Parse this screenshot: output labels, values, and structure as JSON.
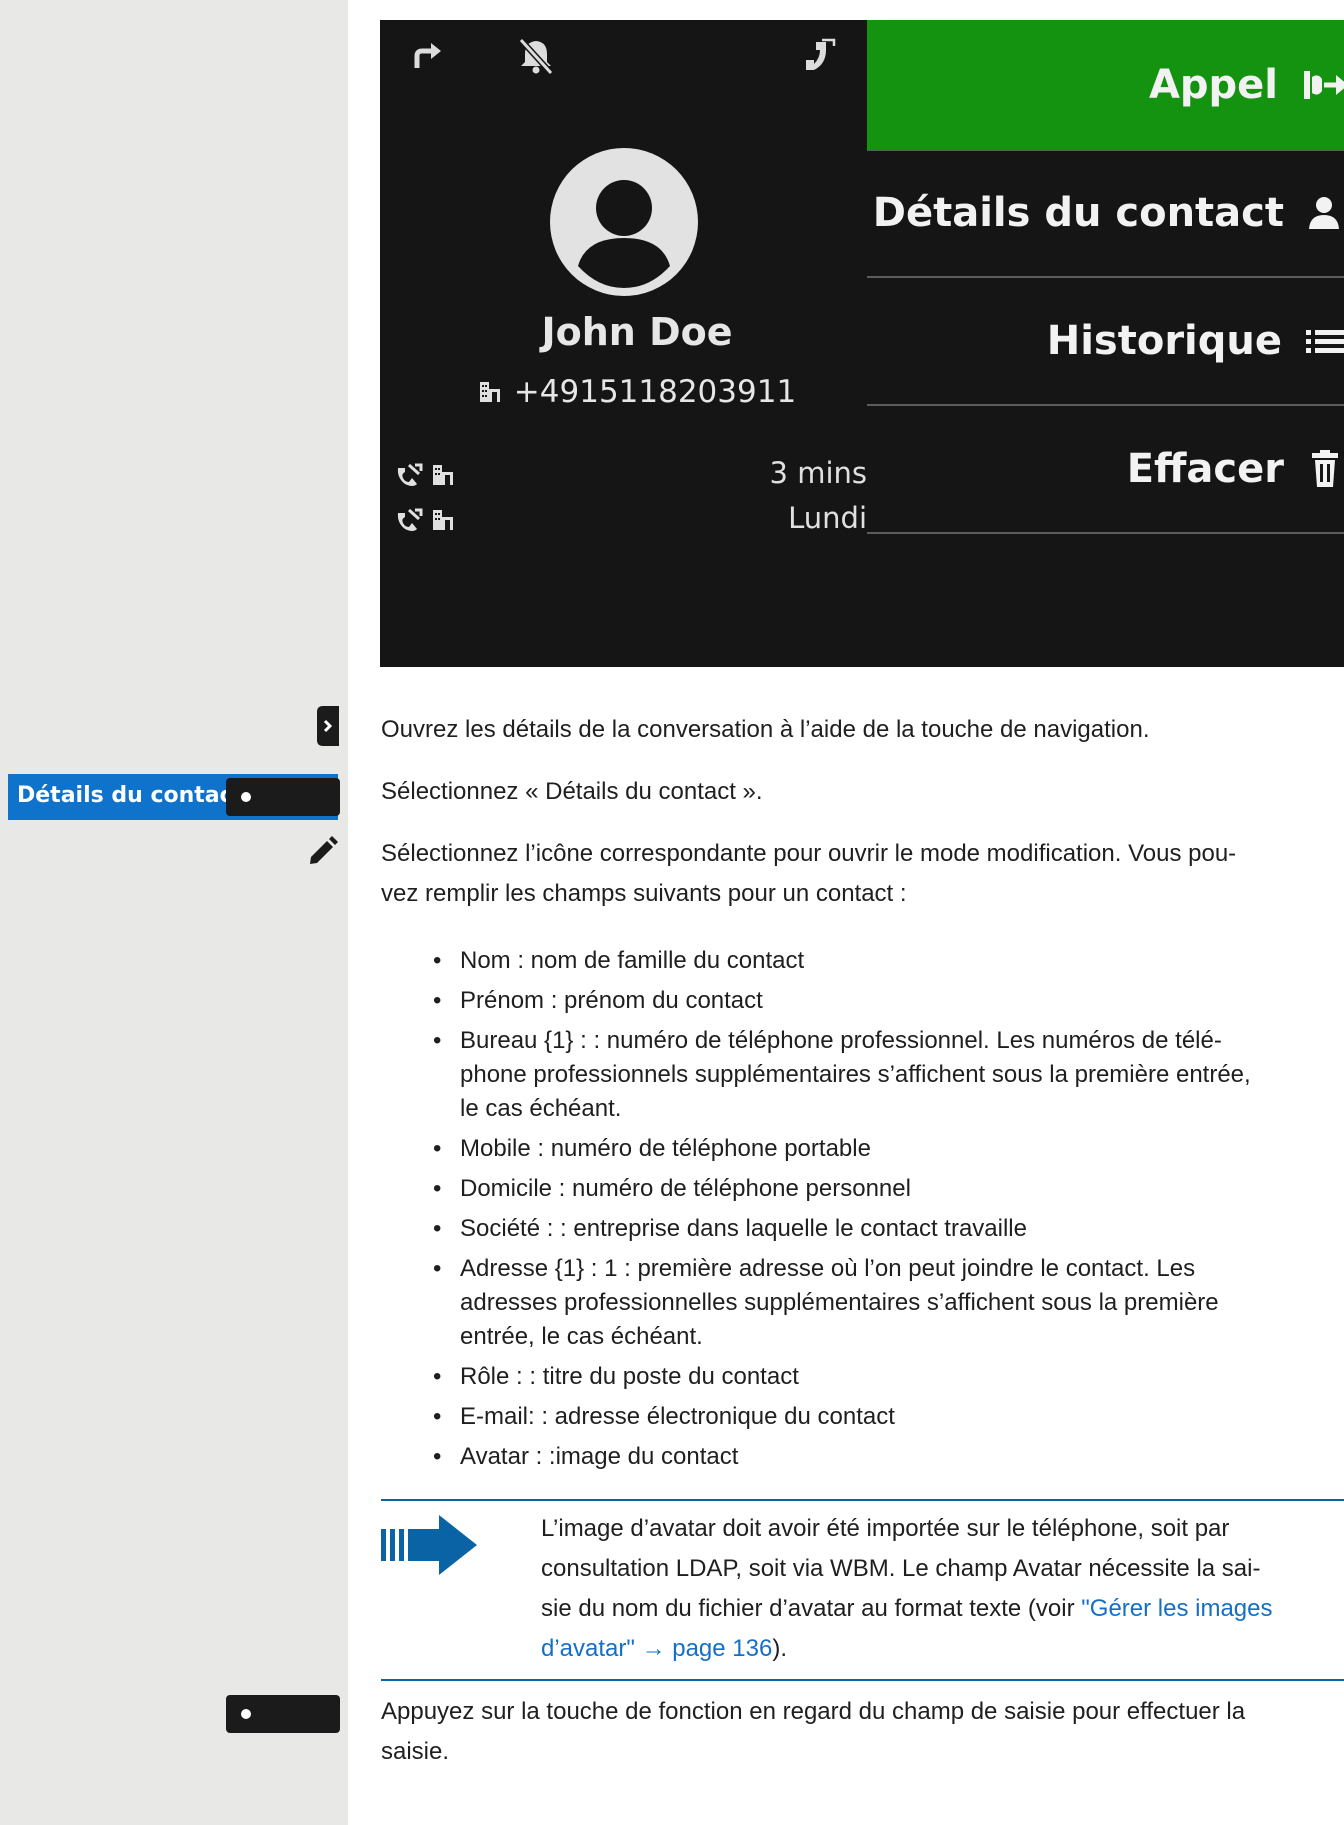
{
  "phone": {
    "status_icons": [
      "forward-arrow-icon",
      "bell-off-icon",
      "phone-handset-icon"
    ],
    "menu": {
      "call_label": "Appel",
      "details_label": "Détails du contact",
      "history_label": "Historique",
      "delete_label": "Effacer"
    },
    "contact": {
      "name": "John Doe",
      "number": "+4915118203911"
    },
    "call_log": [
      {
        "time": "3 mins"
      },
      {
        "time": "Lundi"
      }
    ],
    "colors": {
      "screen_bg": "#151515",
      "call_green": "#13930f"
    }
  },
  "sidebar": {
    "menu_label": "Détails du contact",
    "icons": [
      "navigation-key-icon",
      "pencil-icon"
    ]
  },
  "doc": {
    "step1": "Ouvrez les détails de la conversation à l’aide de la touche de navigation.",
    "step2": "Sélectionnez « Détails du contact ».",
    "step3_line1": "Sélectionnez l’icône correspondante pour ouvrir le mode modification. Vous pou-",
    "step3_line2": "vez remplir les champs suivants pour un contact :",
    "fields": [
      {
        "line1": "Nom : nom de famille du contact",
        "line2": "",
        "line3": ""
      },
      {
        "line1": "Prénom : prénom du contact",
        "line2": "",
        "line3": ""
      },
      {
        "line1": "Bureau {1} : : numéro de téléphone professionnel. Les numéros de télé-",
        "line2": "phone professionnels supplémentaires s’affichent sous la première entrée,",
        "line3": "le cas échéant."
      },
      {
        "line1": "Mobile : numéro de téléphone portable",
        "line2": "",
        "line3": ""
      },
      {
        "line1": "Domicile : numéro de téléphone personnel",
        "line2": "",
        "line3": ""
      },
      {
        "line1": "Société : : entreprise dans laquelle le contact travaille",
        "line2": "",
        "line3": ""
      },
      {
        "line1": "Adresse {1} : 1 : première adresse où l’on peut joindre le contact. Les",
        "line2": "adresses professionnelles supplémentaires s’affichent sous la première",
        "line3": "entrée, le cas échéant."
      },
      {
        "line1": "Rôle : : titre du poste du contact",
        "line2": "",
        "line3": ""
      },
      {
        "line1": "E-mail: : adresse électronique du contact",
        "line2": "",
        "line3": ""
      },
      {
        "line1": "Avatar : :image du contact",
        "line2": "",
        "line3": ""
      }
    ],
    "note": {
      "line1": "L’image d’avatar doit avoir été importée sur le téléphone, soit par",
      "line2": "consultation LDAP, soit via WBM. Le champ Avatar nécessite la sai-",
      "line3_text": "sie du nom du fichier d’avatar au format texte (voir ",
      "link_part1": "\"Gérer les images",
      "link_part2": "d’avatar\" → page 136",
      "line4_tail": ")."
    },
    "step4_line1": "Appuyez sur la touche de fonction en regard du champ de saisie pour effectuer la",
    "step4_line2": "saisie.",
    "colors": {
      "accent_blue": "#0a63a4",
      "link_blue": "#1570c4",
      "margin_gray": "#e8e8e6",
      "label_blue": "#0f73cc"
    }
  }
}
